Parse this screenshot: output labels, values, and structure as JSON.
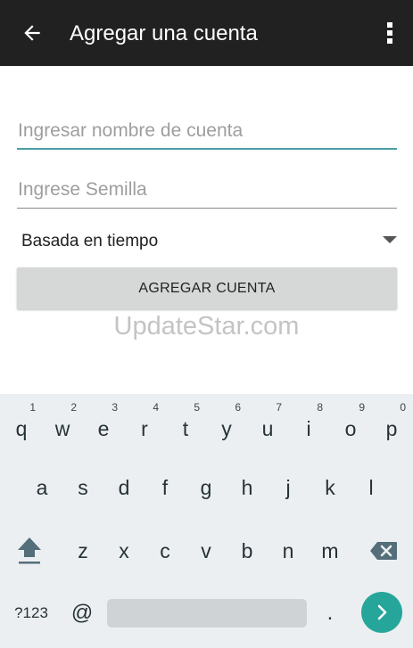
{
  "toolbar": {
    "title": "Agregar una cuenta",
    "back_icon": "arrow-back-icon",
    "overflow_icon": "more-vert-icon",
    "background": "#212121"
  },
  "form": {
    "account_name": {
      "placeholder": "Ingresar nombre de cuenta",
      "value": ""
    },
    "seed": {
      "placeholder": "Ingrese Semilla",
      "value": ""
    },
    "type_select": {
      "value": "Basada en tiempo"
    },
    "add_button": {
      "label": "AGREGAR CUENTA"
    },
    "accent": "#4a9ea5"
  },
  "watermark": {
    "text": "UpdateStar.com"
  },
  "keyboard": {
    "row1": [
      {
        "key": "q",
        "hint": "1"
      },
      {
        "key": "w",
        "hint": "2"
      },
      {
        "key": "e",
        "hint": "3"
      },
      {
        "key": "r",
        "hint": "4"
      },
      {
        "key": "t",
        "hint": "5"
      },
      {
        "key": "y",
        "hint": "6"
      },
      {
        "key": "u",
        "hint": "7"
      },
      {
        "key": "i",
        "hint": "8"
      },
      {
        "key": "o",
        "hint": "9"
      },
      {
        "key": "p",
        "hint": "0"
      }
    ],
    "row2": [
      "a",
      "s",
      "d",
      "f",
      "g",
      "h",
      "j",
      "k",
      "l"
    ],
    "row3": [
      "z",
      "x",
      "c",
      "v",
      "b",
      "n",
      "m"
    ],
    "shift_icon": "shift-icon",
    "delete_icon": "backspace-icon",
    "symbols_label": "?123",
    "at_label": "@",
    "period_label": ".",
    "go_icon": "chevron-right-icon",
    "go_color": "#26a69a"
  }
}
